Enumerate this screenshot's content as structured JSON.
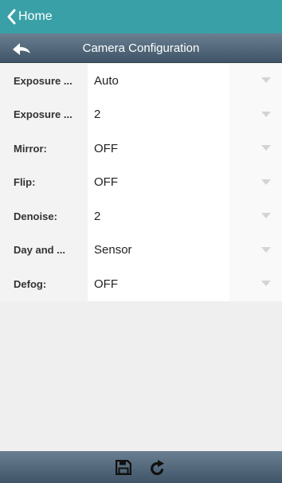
{
  "topbar": {
    "back_label": "Home",
    "icon": "chevron-left-icon",
    "color": "#3aa0a7"
  },
  "navbar": {
    "title": "Camera Configuration",
    "back_icon": "back-arrow-icon"
  },
  "settings": [
    {
      "label": "Exposure ...",
      "value": "Auto"
    },
    {
      "label": "Exposure ...",
      "value": "2"
    },
    {
      "label": "Mirror:",
      "value": "OFF"
    },
    {
      "label": "Flip:",
      "value": "OFF"
    },
    {
      "label": "Denoise:",
      "value": "2"
    },
    {
      "label": "Day and ...",
      "value": "Sensor"
    },
    {
      "label": "Defog:",
      "value": "OFF"
    }
  ],
  "toolbar": {
    "save_icon": "save-icon",
    "refresh_icon": "refresh-icon"
  }
}
